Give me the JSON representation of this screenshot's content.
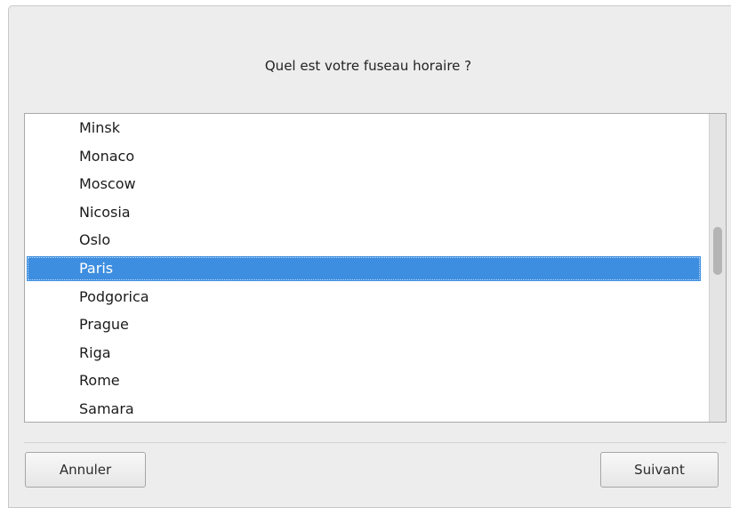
{
  "dialog": {
    "question": "Quel est votre fuseau horaire ?"
  },
  "timezone_list": {
    "items": [
      "Minsk",
      "Monaco",
      "Moscow",
      "Nicosia",
      "Oslo",
      "Paris",
      "Podgorica",
      "Prague",
      "Riga",
      "Rome",
      "Samara"
    ],
    "selected": "Paris",
    "scroll_position": 0.38
  },
  "buttons": {
    "cancel_label": "Annuler",
    "next_label": "Suivant"
  },
  "colors": {
    "selection": "#3d8ee0",
    "window_background": "#ededed"
  }
}
